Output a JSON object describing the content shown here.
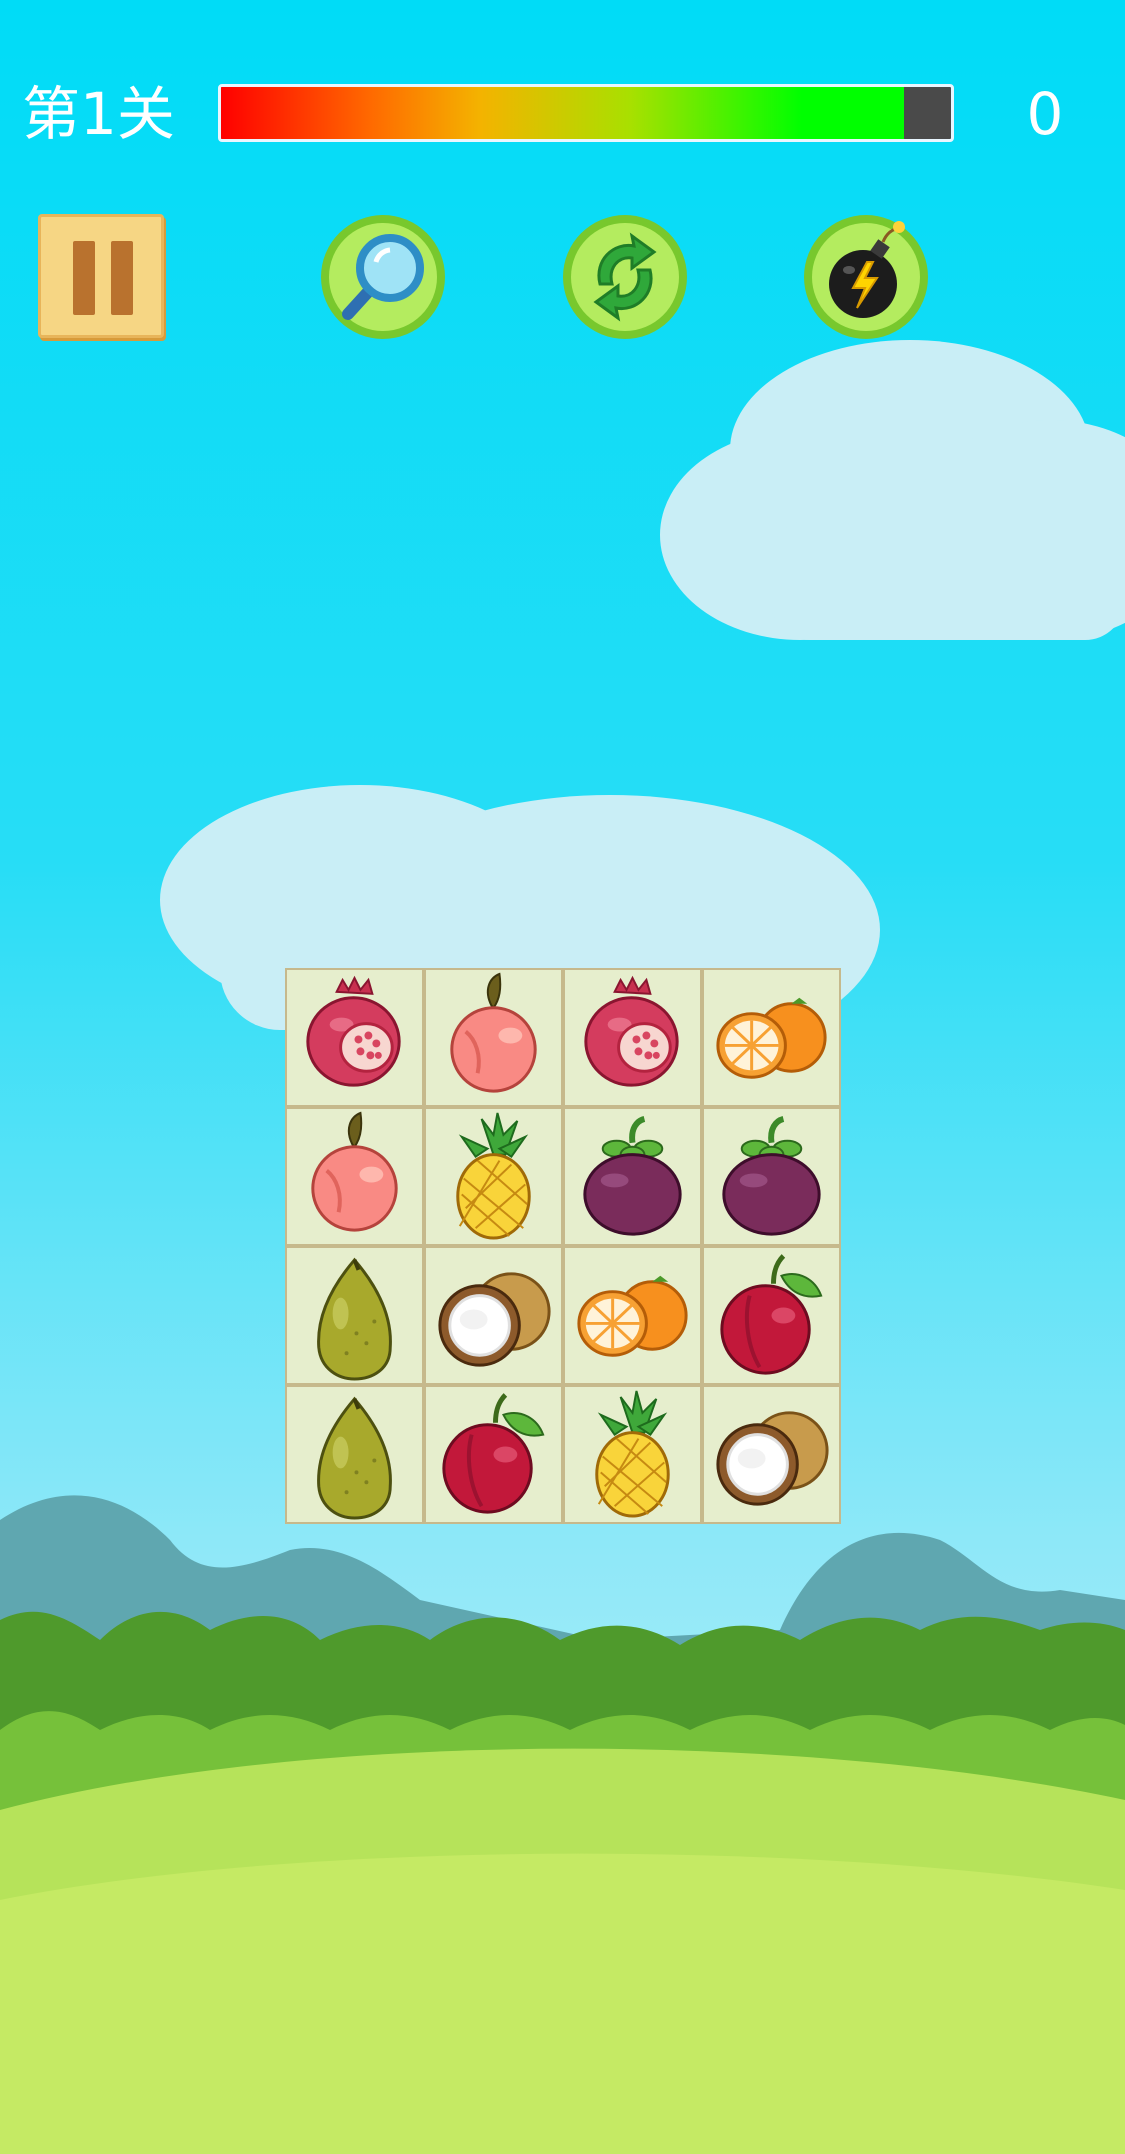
{
  "hud": {
    "level_label": "第1关",
    "score": "0",
    "timer_remaining_fraction": 0.935
  },
  "toolbar": {
    "pause_icon": "pause-icon",
    "hint_icon": "magnifier-icon",
    "shuffle_icon": "refresh-arrows-icon",
    "bomb_icon": "bomb-icon"
  },
  "board": {
    "rows": 4,
    "cols": 4,
    "tiles": [
      [
        "pomegranate",
        "peach",
        "pomegranate",
        "orange"
      ],
      [
        "peach",
        "pineapple",
        "mangosteen",
        "mangosteen"
      ],
      [
        "pear",
        "coconut",
        "orange",
        "plum"
      ],
      [
        "pear",
        "plum",
        "pineapple",
        "coconut"
      ]
    ]
  },
  "colors": {
    "sky": "#00dcf7",
    "board_tile": "#e6eecd",
    "button_green": "#9be23c"
  }
}
